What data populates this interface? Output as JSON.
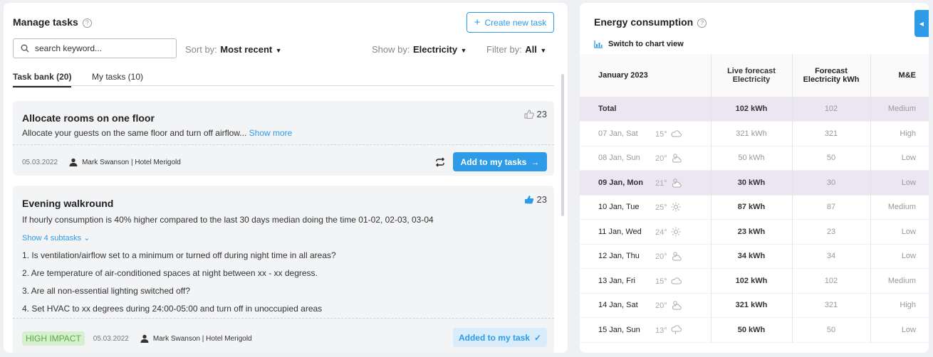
{
  "tasks_panel": {
    "title": "Manage tasks",
    "help_icon": "?",
    "create_button": "Create new task",
    "search_placeholder": "search keyword...",
    "sort_label": "Sort by:",
    "sort_value": "Most recent",
    "show_label": "Show by:",
    "show_value": "Electricity",
    "filter_label": "Filter by:",
    "filter_value": "All",
    "tabs": [
      "Task bank (20)",
      "My tasks (10)"
    ],
    "cards": [
      {
        "title": "Allocate rooms on one floor",
        "description": "Allocate your guests on the same floor and turn off airflow...",
        "show_more": "Show more",
        "likes": "23",
        "date": "05.03.2022",
        "author": "Mark Swanson | Hotel Merigold",
        "action": "Add to my tasks"
      },
      {
        "title": "Evening walkround",
        "description": "If hourly consumption is 40% higher compared to the last 30 days median doing the time 01-02, 02-03, 03-04",
        "show_subtasks": "Show 4 subtasks",
        "subtasks": [
          "1. Is ventilation/airflow set to a minimum or turned off during night time in all areas?",
          "2. Are temperature of air-conditioned spaces at night between xx - xx degress.",
          "3. Are all non-essential lighting switched off?",
          "4. Set HVAC to xx degrees during 24:00-05:00 and turn off in unoccupied areas"
        ],
        "likes": "23",
        "badge": "HIGH IMPACT",
        "date": "05.03.2022",
        "author": "Mark Swanson | Hotel Merigold",
        "action": "Added to my task"
      }
    ]
  },
  "energy_panel": {
    "title": "Energy consumption",
    "help_icon": "?",
    "switch_view": "Switch to chart view",
    "headers": {
      "month": "January 2023",
      "live": "Live forecast Electricity",
      "forecast": "Forecast Electricity kWh",
      "me": "M&E"
    },
    "total": {
      "label": "Total",
      "live": "102 kWh",
      "forecast": "102",
      "me": "Medium"
    },
    "rows": [
      {
        "date": "07 Jan, Sat",
        "temp": "15°",
        "icon": "cloud-icon",
        "live": "321 kWh",
        "forecast": "321",
        "me": "High"
      },
      {
        "date": "08 Jan, Sun",
        "temp": "20°",
        "icon": "partly-cloudy-icon",
        "live": "50 kWh",
        "forecast": "50",
        "me": "Low"
      },
      {
        "date": "09 Jan, Mon",
        "temp": "21°",
        "icon": "partly-cloudy-icon",
        "live": "30 kWh",
        "forecast": "30",
        "me": "Low"
      },
      {
        "date": "10 Jan, Tue",
        "temp": "25°",
        "icon": "sun-icon",
        "live": "87 kWh",
        "forecast": "87",
        "me": "Medium"
      },
      {
        "date": "11 Jan, Wed",
        "temp": "24°",
        "icon": "sun-icon",
        "live": "23 kWh",
        "forecast": "23",
        "me": "Low"
      },
      {
        "date": "12 Jan, Thu",
        "temp": "20°",
        "icon": "partly-cloudy-icon",
        "live": "34 kWh",
        "forecast": "34",
        "me": "Low"
      },
      {
        "date": "13 Jan, Fri",
        "temp": "15°",
        "icon": "cloud-icon",
        "live": "102 kWh",
        "forecast": "102",
        "me": "Medium"
      },
      {
        "date": "14 Jan, Sat",
        "temp": "20°",
        "icon": "partly-cloudy-icon",
        "live": "321 kWh",
        "forecast": "321",
        "me": "High"
      },
      {
        "date": "15 Jan, Sun",
        "temp": "13°",
        "icon": "rain-cloud-icon",
        "live": "50 kWh",
        "forecast": "50",
        "me": "Low"
      }
    ]
  },
  "colors": {
    "accent": "#2d9be8",
    "highlight_row": "#ece6f3",
    "impact_badge": "#d6f0cf"
  }
}
